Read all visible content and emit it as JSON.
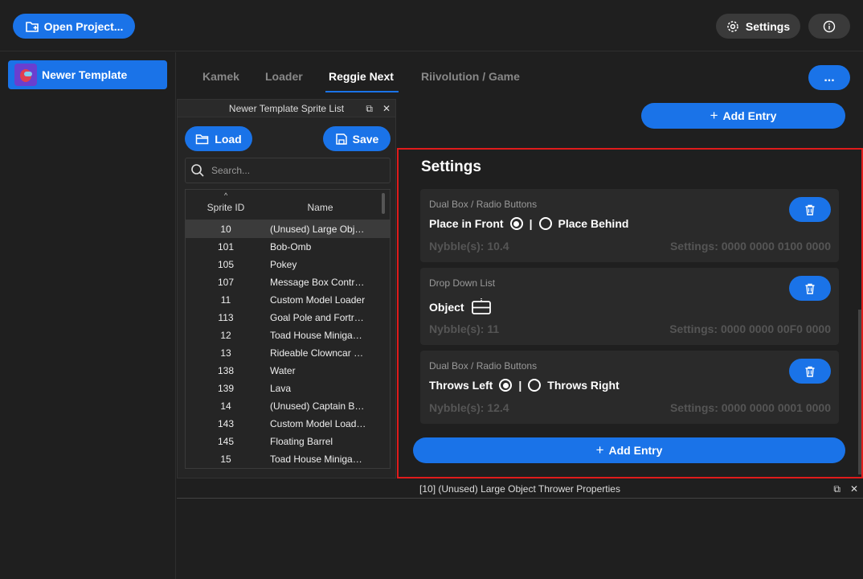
{
  "topbar": {
    "open_project_label": "Open Project...",
    "settings_label": "Settings"
  },
  "sidebar": {
    "project_name": "Newer Template"
  },
  "tabs": [
    {
      "label": "Kamek"
    },
    {
      "label": "Loader"
    },
    {
      "label": "Reggie Next"
    },
    {
      "label": "Riivolution / Game"
    }
  ],
  "toolbar": {
    "more_label": "...",
    "add_entry_label": "Add Entry"
  },
  "sprite_panel": {
    "title": "Newer Template Sprite List",
    "load_label": "Load",
    "save_label": "Save",
    "search_placeholder": "Search...",
    "col_id": "Sprite ID",
    "col_name": "Name",
    "rows": [
      {
        "id": "10",
        "name": "(Unused) Large Objec..."
      },
      {
        "id": "101",
        "name": "Bob-Omb"
      },
      {
        "id": "105",
        "name": "Pokey"
      },
      {
        "id": "107",
        "name": "Message Box Control..."
      },
      {
        "id": "11",
        "name": "Custom Model Loader"
      },
      {
        "id": "113",
        "name": "Goal Pole and Fortress"
      },
      {
        "id": "12",
        "name": "Toad House Minigam..."
      },
      {
        "id": "13",
        "name": "Rideable Clowncar wi..."
      },
      {
        "id": "138",
        "name": "Water"
      },
      {
        "id": "139",
        "name": "Lava"
      },
      {
        "id": "14",
        "name": "(Unused) Captain Bo..."
      },
      {
        "id": "143",
        "name": "Custom Model Loade..."
      },
      {
        "id": "145",
        "name": "Floating Barrel"
      },
      {
        "id": "15",
        "name": "Toad House Minigam..."
      }
    ]
  },
  "settings": {
    "title": "Settings",
    "entries": [
      {
        "type": "Dual Box / Radio Buttons",
        "option_a": "Place in Front",
        "separator": "|",
        "option_b": "Place Behind",
        "nybbles": "Nybble(s): 10.4",
        "settings": "Settings: 0000 0000 0100 0000"
      },
      {
        "type": "Drop Down List",
        "label": "Object",
        "nybbles": "Nybble(s): 11",
        "settings": "Settings: 0000 0000 00F0 0000"
      },
      {
        "type": "Dual Box / Radio Buttons",
        "option_a": "Throws Left",
        "separator": "|",
        "option_b": "Throws Right",
        "nybbles": "Nybble(s): 12.4",
        "settings": "Settings: 0000 0000 0001 0000"
      }
    ],
    "add_entry_label": "Add Entry"
  },
  "properties_panel": {
    "title": "[10] (Unused) Large Object Thrower Properties"
  },
  "colors": {
    "accent": "#1a73e8",
    "highlight_border": "#e01b1b"
  }
}
